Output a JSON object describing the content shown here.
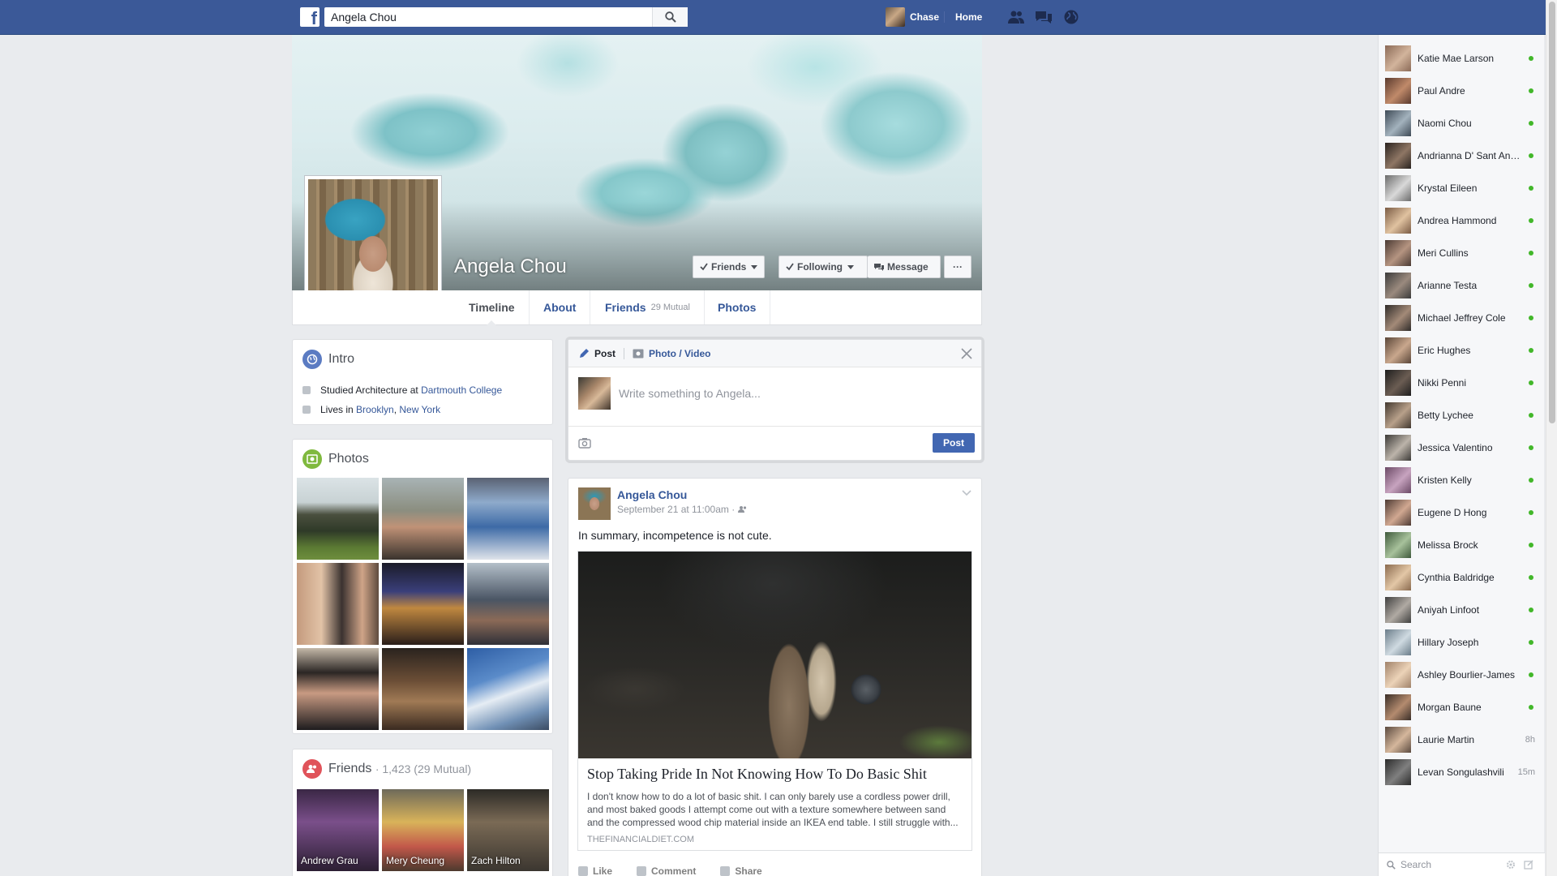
{
  "topbar": {
    "search_value": "Angela Chou",
    "user_name": "Chase",
    "home_label": "Home",
    "icons": [
      "friend-requests-icon",
      "messages-icon",
      "notifications-globe-icon"
    ],
    "brand_color": "#3b5998"
  },
  "profile": {
    "name": "Angela Chou",
    "buttons": {
      "friends": "Friends",
      "following": "Following",
      "message": "Message",
      "more": "···"
    },
    "tabs": [
      {
        "label": "Timeline",
        "sub": ""
      },
      {
        "label": "About",
        "sub": ""
      },
      {
        "label": "Friends",
        "sub": "29 Mutual"
      },
      {
        "label": "Photos",
        "sub": ""
      }
    ]
  },
  "intro": {
    "title": "Intro",
    "education": {
      "prefix": "Studied Architecture at",
      "school": "Dartmouth College"
    },
    "location": {
      "prefix": "Lives in",
      "city": "Brooklyn",
      "state": "New York"
    }
  },
  "photos": {
    "title": "Photos"
  },
  "friends": {
    "title": "Friends",
    "count": "· 1,423 (29 Mutual)",
    "list": [
      {
        "name": "Andrew Grau"
      },
      {
        "name": "Mery Cheung"
      },
      {
        "name": "Zach Hilton"
      }
    ]
  },
  "composer": {
    "tab_post": "Post",
    "tab_photo": "Photo / Video",
    "placeholder": "Write something to Angela...",
    "post_button": "Post"
  },
  "story": {
    "author": "Angela Chou",
    "timestamp": "September 21 at 11:00am ·",
    "text": "In summary, incompetence is not cute.",
    "link": {
      "title": "Stop Taking Pride In Not Knowing How To Do Basic Shit",
      "description": "I don't know how to do a lot of basic shit. I can only barely use a cordless power drill, and most baked goods I attempt come out with a texture somewhere between sand and the compressed wood chip material inside an IKEA end table. I still struggle with...",
      "domain": "THEFINANCIALDIET.COM"
    },
    "actions": {
      "like": "Like",
      "comment": "Comment",
      "share": "Share"
    }
  },
  "chat": {
    "contacts": [
      {
        "name": "Katie Mae Larson",
        "status": "online"
      },
      {
        "name": "Paul Andre",
        "status": "online"
      },
      {
        "name": "Naomi Chou",
        "status": "online"
      },
      {
        "name": "Andrianna D' Sant Angelo",
        "status": "online"
      },
      {
        "name": "Krystal Eileen",
        "status": "online"
      },
      {
        "name": "Andrea Hammond",
        "status": "online"
      },
      {
        "name": "Meri Cullins",
        "status": "online"
      },
      {
        "name": "Arianne Testa",
        "status": "online"
      },
      {
        "name": "Michael Jeffrey Cole",
        "status": "online"
      },
      {
        "name": "Eric Hughes",
        "status": "online"
      },
      {
        "name": "Nikki Penni",
        "status": "online"
      },
      {
        "name": "Betty Lychee",
        "status": "online"
      },
      {
        "name": "Jessica Valentino",
        "status": "online"
      },
      {
        "name": "Kristen Kelly",
        "status": "online"
      },
      {
        "name": "Eugene D Hong",
        "status": "online"
      },
      {
        "name": "Melissa Brock",
        "status": "online"
      },
      {
        "name": "Cynthia Baldridge",
        "status": "online"
      },
      {
        "name": "Aniyah Linfoot",
        "status": "online"
      },
      {
        "name": "Hillary Joseph",
        "status": "online"
      },
      {
        "name": "Ashley Bourlier-James",
        "status": "online"
      },
      {
        "name": "Morgan Baune",
        "status": "online"
      },
      {
        "name": "Laurie Martin",
        "status": "8h"
      },
      {
        "name": "Levan Songulashvili",
        "status": "15m"
      }
    ],
    "search_placeholder": "Search",
    "online_color": "#42b72a"
  }
}
